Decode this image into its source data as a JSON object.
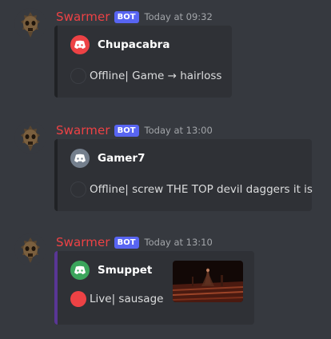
{
  "messages": [
    {
      "username": "Swarmer",
      "bot_tag": "BOT",
      "timestamp": "Today at 09:32",
      "accent_color": "#202225",
      "embed": {
        "author_name": "Chupacabra",
        "author_icon": "discord-icon",
        "author_icon_color": "#ed4245",
        "status_color": "#2f3136",
        "description": "Offline| Game → hairloss"
      }
    },
    {
      "username": "Swarmer",
      "bot_tag": "BOT",
      "timestamp": "Today at 13:00",
      "accent_color": "#202225",
      "embed": {
        "author_name": "Gamer7",
        "author_icon": "discord-icon",
        "author_icon_color": "#747f8d",
        "status_color": "#2f3136",
        "description": "Offline| screw THE TOP devil daggers it is"
      }
    },
    {
      "username": "Swarmer",
      "bot_tag": "BOT",
      "timestamp": "Today at 13:10",
      "accent_color": "#593695",
      "embed": {
        "author_name": "Smuppet",
        "author_icon": "discord-icon",
        "author_icon_color": "#3ba55c",
        "status_color": "#ed4245",
        "description": "Live| sausage",
        "thumbnail": "game-screenshot-thumbnail"
      }
    }
  ],
  "colors": {
    "background": "#36393f",
    "embed_background": "#2f3136",
    "username": "#ed4245",
    "bot_tag": "#5865f2"
  }
}
